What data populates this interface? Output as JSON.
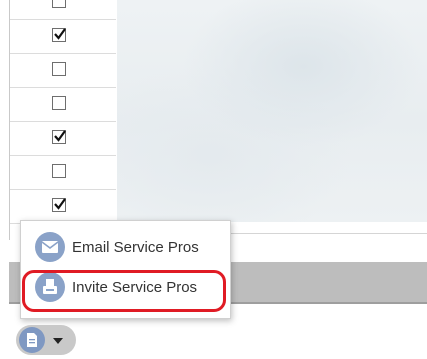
{
  "checkbox_column": {
    "rows": [
      {
        "checked": false
      },
      {
        "checked": true
      },
      {
        "checked": false
      },
      {
        "checked": false
      },
      {
        "checked": true
      },
      {
        "checked": false
      },
      {
        "checked": true
      }
    ]
  },
  "popup_menu": {
    "items": [
      {
        "label": "Email Service Pros",
        "icon": "envelope-icon"
      },
      {
        "label": "Invite Service Pros",
        "icon": "invite-icon"
      }
    ],
    "highlighted_item": "Invite Service Pros"
  },
  "action_button": {
    "icon": "document-icon",
    "caret": "caret-down-icon"
  },
  "colors": {
    "icon_blue": "#8aa2c8",
    "highlight_red": "#e01b24",
    "toolbar_grey": "#bdbdbd"
  }
}
